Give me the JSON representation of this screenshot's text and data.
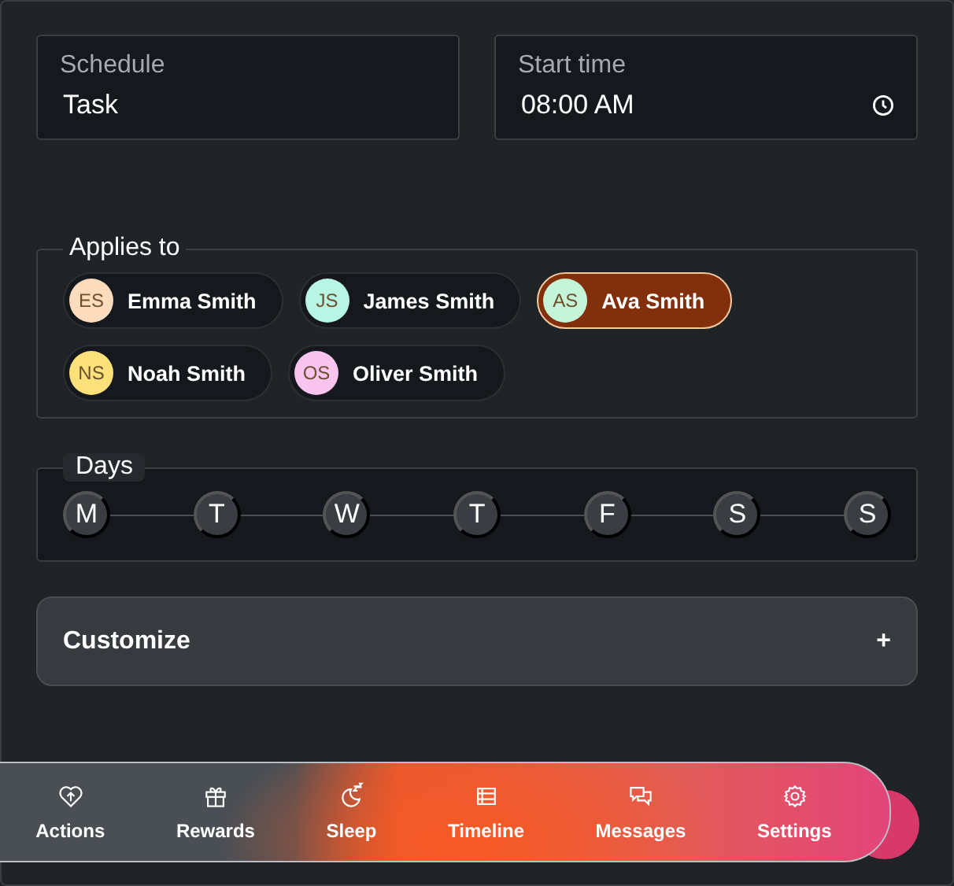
{
  "schedule": {
    "label": "Schedule",
    "value": "Task"
  },
  "start_time": {
    "label": "Start time",
    "value": "08:00 AM"
  },
  "applies_to": {
    "legend": "Applies to",
    "people": [
      {
        "initials": "ES",
        "name": "Emma Smith",
        "color": "#fcdcbc",
        "selected": false
      },
      {
        "initials": "JS",
        "name": "James Smith",
        "color": "#b8f5e2",
        "selected": false
      },
      {
        "initials": "AS",
        "name": "Ava Smith",
        "color": "#c4f5d8",
        "selected": true
      },
      {
        "initials": "NS",
        "name": "Noah Smith",
        "color": "#fce07a",
        "selected": false
      },
      {
        "initials": "OS",
        "name": "Oliver Smith",
        "color": "#f9c4ee",
        "selected": false
      }
    ]
  },
  "days": {
    "legend": "Days",
    "items": [
      "M",
      "T",
      "W",
      "T",
      "F",
      "S",
      "S"
    ]
  },
  "customize": {
    "label": "Customize",
    "icon": "+"
  },
  "nav": [
    {
      "label": "Actions",
      "kind": "heart"
    },
    {
      "label": "Rewards",
      "kind": "gift"
    },
    {
      "label": "Sleep",
      "kind": "moon"
    },
    {
      "label": "Timeline",
      "kind": "list"
    },
    {
      "label": "Messages",
      "kind": "chat"
    },
    {
      "label": "Settings",
      "kind": "gear"
    }
  ]
}
